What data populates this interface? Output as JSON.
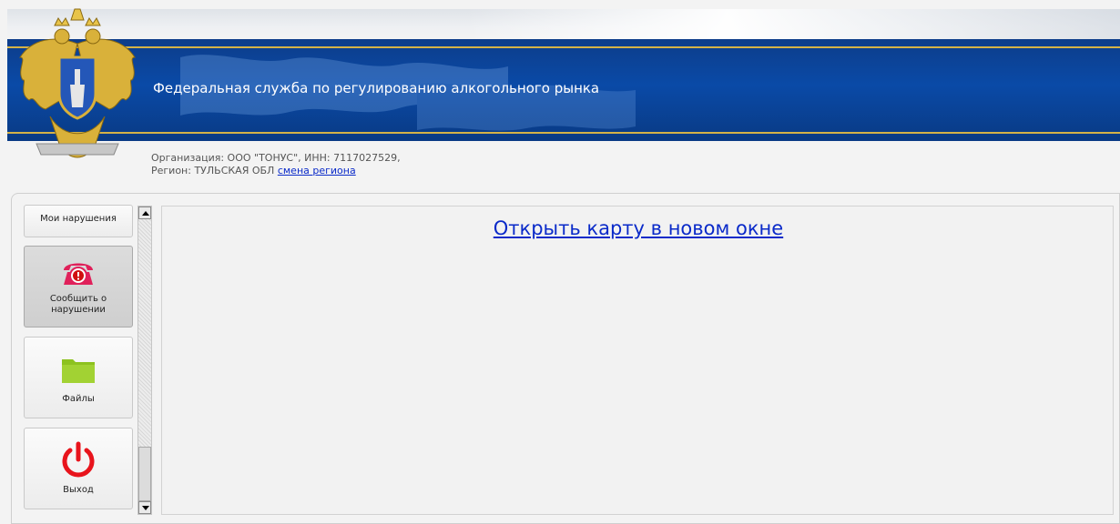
{
  "header": {
    "title": "Федеральная служба по регулированию алкогольного рынка",
    "org_line": "Организация: ООО \"ТОНУС\", ИНН: 7117027529,",
    "region_prefix": "Регион: ТУЛЬСКАЯ ОБЛ",
    "change_region_link": "смена региона"
  },
  "sidebar": {
    "items": [
      {
        "label": "Мои нарушения",
        "icon": "list-icon"
      },
      {
        "label": "Сообщить о нарушении",
        "icon": "alert-phone-icon"
      },
      {
        "label": "Файлы",
        "icon": "folder-icon"
      },
      {
        "label": "Выход",
        "icon": "power-icon"
      }
    ]
  },
  "main": {
    "map_link": "Открыть карту в новом окне"
  },
  "colors": {
    "banner_blue": "#0a4aa7",
    "gold_line": "#d5b247",
    "link_blue": "#0a2ac9",
    "power_red": "#e8141c",
    "folder_green": "#8dc21f"
  }
}
